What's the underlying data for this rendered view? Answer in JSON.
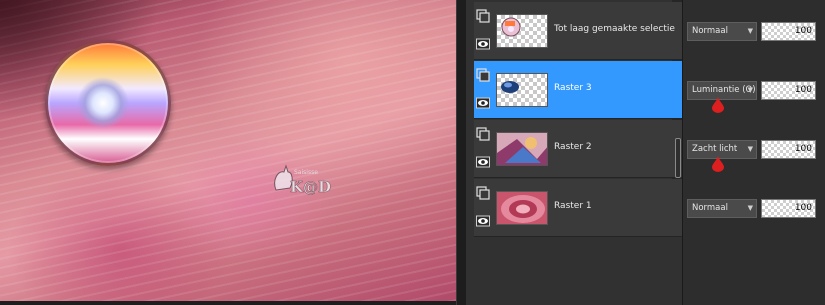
{
  "colors": {
    "selected_row": "#3399ff",
    "panel_bg": "#313131",
    "marker": "#dd1f1f"
  },
  "canvas": {
    "watermark_top": "Saisisse",
    "watermark_main": "K@D"
  },
  "layers": [
    {
      "name": "Tot laag gemaakte selectie",
      "blend_mode": "Normaal",
      "opacity": "100",
      "selected": false,
      "thumb": "selection-thumb",
      "marker": false
    },
    {
      "name": "Raster 3",
      "blend_mode": "Luminantie (O)",
      "opacity": "100",
      "selected": true,
      "thumb": "blue-blob-thumb",
      "marker": true
    },
    {
      "name": "Raster 2",
      "blend_mode": "Zacht licht",
      "opacity": "100",
      "selected": false,
      "thumb": "image-thumb",
      "marker": true
    },
    {
      "name": "Raster 1",
      "blend_mode": "Normaal",
      "opacity": "100",
      "selected": false,
      "thumb": "pink-tunnel-thumb",
      "marker": false
    }
  ],
  "icons": {
    "layer_type": "raster-layer-icon",
    "visibility": "eye-icon",
    "dropdown": "chevron-down-icon",
    "marker": "drop-marker-icon"
  }
}
